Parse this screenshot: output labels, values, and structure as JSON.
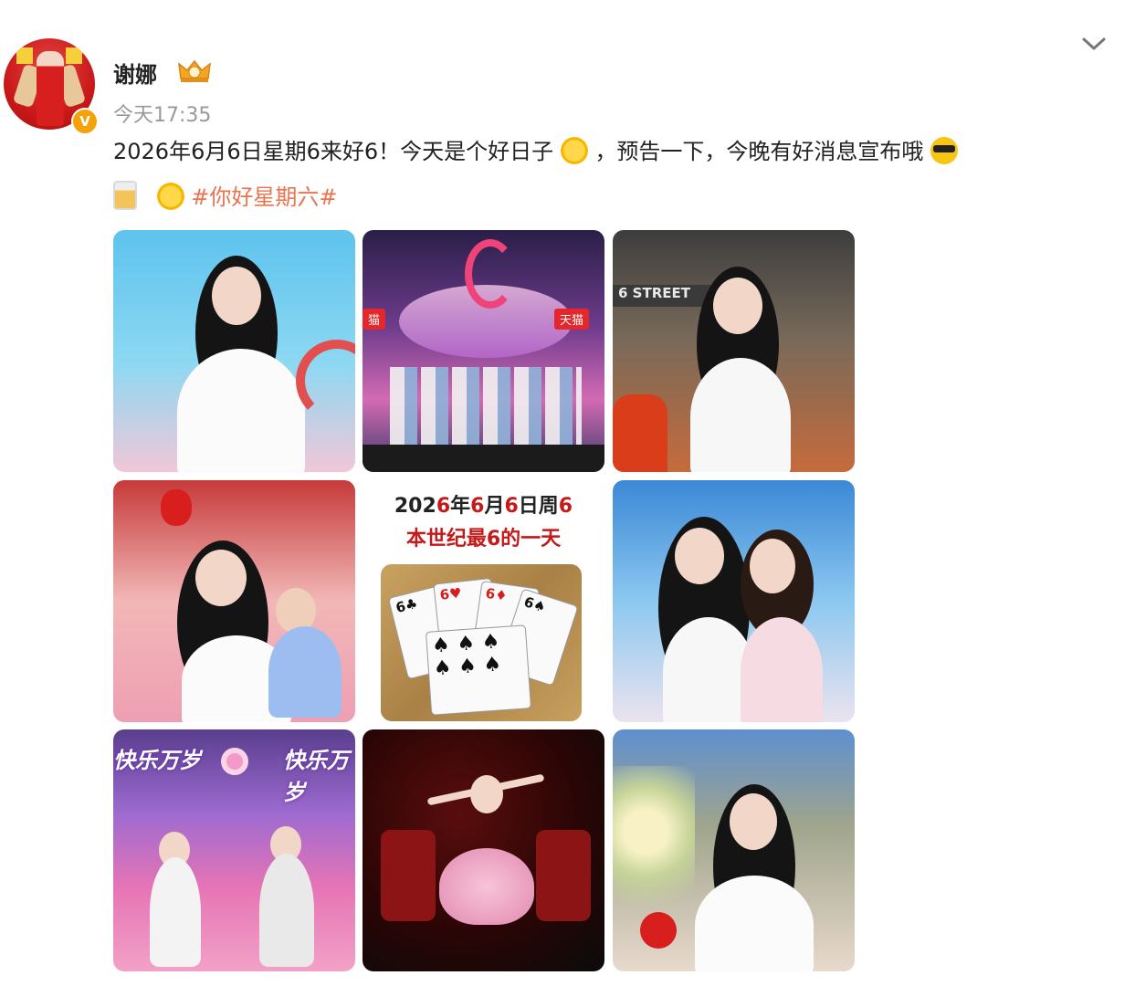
{
  "post": {
    "author": "谢娜",
    "timestamp": "今天17:35",
    "text_line1": "2026年6月6日星期6来好6！今天是个好日子",
    "text_line1_after_emoji": "，预告一下，今晚有好消息宣布哦",
    "hashtag": "#你好星期六#",
    "icons": [
      "vip-crown-icon",
      "verified-badge-icon",
      "chevron-down-icon",
      "sun-emoji-icon",
      "cool-sunglasses-emoji-icon",
      "beer-emoji-icon"
    ],
    "verified_mark": "V"
  },
  "images": {
    "count": 9,
    "poster": {
      "line1_prefix": "202",
      "line1_red1": "6",
      "line1_mid1": "年",
      "line1_red2": "6",
      "line1_mid2": "月",
      "line1_red3": "6",
      "line1_mid3": "日周",
      "line1_red4": "6",
      "line2": "本世纪最6的一天",
      "card_rank": "6"
    },
    "stage_tags": [
      "猫",
      "天猫"
    ],
    "banner_texts": [
      "快乐万岁",
      "快乐万岁"
    ],
    "street_sign": "6 STREET"
  },
  "colors": {
    "hashtag": "#eb7350",
    "timestamp": "#999999",
    "verified": "#f5a20a"
  }
}
